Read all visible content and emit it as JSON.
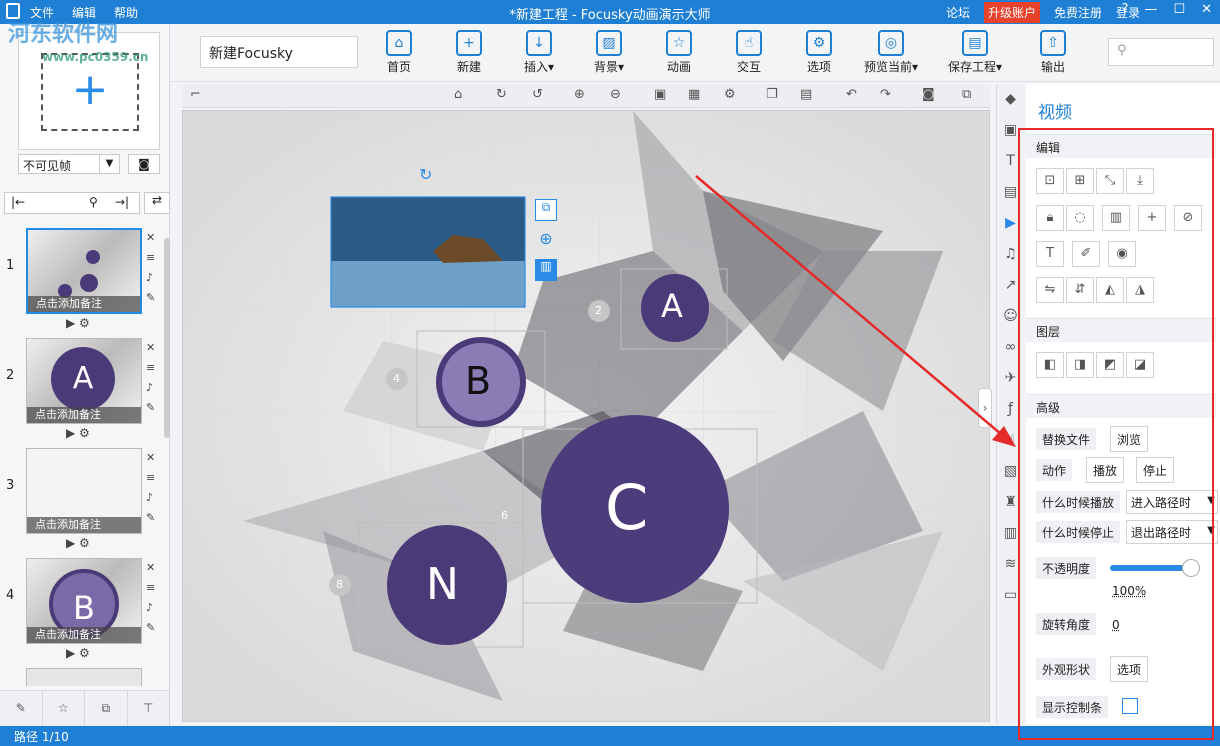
{
  "title": {
    "menu": [
      "文件",
      "编辑",
      "帮助"
    ],
    "app_title": "*新建工程 - Focusky动画演示大师",
    "forum": "论坛",
    "upgrade": "升级账户",
    "register": "免费注册",
    "login": "登录",
    "win_btns": [
      "?",
      "—",
      "☐",
      "✕"
    ]
  },
  "watermark": {
    "name": "河东软件网",
    "url": "www.pc0359.cn"
  },
  "toolbar": {
    "project_name": "新建Focusky",
    "buttons": [
      {
        "label": "首页",
        "icon": "home-icon",
        "glyph": "⌂"
      },
      {
        "label": "新建",
        "icon": "new-icon",
        "glyph": "+"
      },
      {
        "label": "插入",
        "icon": "insert-icon",
        "glyph": "↓"
      },
      {
        "label": "背景",
        "icon": "background-icon",
        "glyph": "▨"
      },
      {
        "label": "动画",
        "icon": "animation-icon",
        "glyph": "☆"
      },
      {
        "label": "交互",
        "icon": "interaction-icon",
        "glyph": "☝"
      },
      {
        "label": "选项",
        "icon": "options-icon",
        "glyph": "⚙"
      },
      {
        "label": "预览当前",
        "icon": "preview-icon",
        "glyph": "◎"
      },
      {
        "label": "保存工程",
        "icon": "save-icon",
        "glyph": "▤"
      },
      {
        "label": "输出",
        "icon": "export-icon",
        "glyph": "⇧"
      }
    ],
    "search_icon": "⚲"
  },
  "left": {
    "visibility": "不可见帧",
    "slides": [
      {
        "num": "1",
        "note": "点击添加备注"
      },
      {
        "num": "2",
        "note": "点击添加备注",
        "letter": "A"
      },
      {
        "num": "3",
        "note": "点击添加备注"
      },
      {
        "num": "4",
        "note": "点击添加备注",
        "letter": "B"
      }
    ]
  },
  "canvas": {
    "circles": [
      "A",
      "B",
      "C",
      "N"
    ],
    "markers": [
      "2",
      "4",
      "6",
      "8"
    ]
  },
  "props": {
    "title": "视频",
    "edit": "编辑",
    "layer": "图层",
    "advanced": "高级",
    "replace_file": "替换文件",
    "browse": "浏览",
    "action": "动作",
    "play": "播放",
    "stop": "停止",
    "when_play": "什么时候播放",
    "when_play_value": "进入路径时",
    "when_stop": "什么时候停止",
    "when_stop_value": "退出路径时",
    "opacity": "不透明度",
    "opacity_value": "100%",
    "rotation": "旋转角度",
    "rotation_value": "0",
    "appearance": "外观形状",
    "options": "选项",
    "show_controls": "显示控制条"
  },
  "status": {
    "path": "路径 1/10"
  }
}
